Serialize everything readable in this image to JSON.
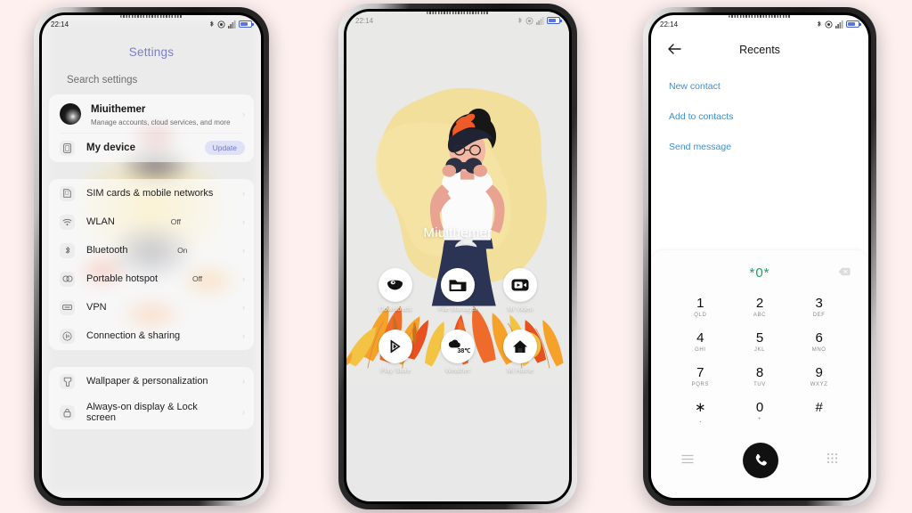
{
  "page": {
    "background_color": "#fdf0ef",
    "phone_count": 3
  },
  "status_bar": {
    "time": "22:14",
    "icons": [
      "bluetooth-icon",
      "dnd-icon",
      "signal-icon",
      "battery-icon"
    ]
  },
  "phone_settings": {
    "title": "Settings",
    "search_placeholder": "Search settings",
    "account": {
      "name": "Miuithemer",
      "subtitle": "Manage accounts, cloud services, and more"
    },
    "device": {
      "label": "My device",
      "badge": "Update",
      "badge_color": "#6f78c8",
      "badge_bg": "#dfe1f7"
    },
    "groups": [
      {
        "items": [
          {
            "label": "SIM cards & mobile networks",
            "value": "",
            "icon": "sim-card-icon"
          },
          {
            "label": "WLAN",
            "value": "Off",
            "icon": "wifi-icon"
          },
          {
            "label": "Bluetooth",
            "value": "On",
            "icon": "bluetooth-icon"
          },
          {
            "label": "Portable hotspot",
            "value": "Off",
            "icon": "hotspot-icon"
          },
          {
            "label": "VPN",
            "value": "",
            "icon": "vpn-icon"
          },
          {
            "label": "Connection & sharing",
            "value": "",
            "icon": "connection-sharing-icon"
          }
        ]
      },
      {
        "items": [
          {
            "label": "Wallpaper & personalization",
            "value": "",
            "icon": "wallpaper-icon"
          },
          {
            "label": "Always-on display & Lock screen",
            "value": "",
            "icon": "lock-icon"
          }
        ]
      }
    ],
    "title_color": "#7b7fc4"
  },
  "phone_home": {
    "wallpaper_name": "Miuithemer",
    "wallpaper_description": "Illustrated woman with binoculars on yellow blob with autumn leaves",
    "apps": [
      {
        "label": "Downloads",
        "icon": "downloads-icon"
      },
      {
        "label": "File Manager",
        "icon": "folder-icon"
      },
      {
        "label": "Mi Video",
        "icon": "video-play-icon"
      },
      {
        "label": "Play Store",
        "icon": "play-store-icon"
      },
      {
        "label": "Weather",
        "icon": "weather-cloud-icon",
        "badge": "38℃"
      },
      {
        "label": "Mi Home",
        "icon": "home-icon"
      }
    ]
  },
  "phone_dialer": {
    "title": "Recents",
    "back_icon": "back-arrow-icon",
    "links": [
      "New contact",
      "Add to contacts",
      "Send message"
    ],
    "link_color": "#3b8fd4",
    "entry": "*0*",
    "entry_color": "#1aa463",
    "backspace_icon": "backspace-icon",
    "keys": [
      {
        "digit": "1",
        "sub": "QLD"
      },
      {
        "digit": "2",
        "sub": "ABC"
      },
      {
        "digit": "3",
        "sub": "DEF"
      },
      {
        "digit": "4",
        "sub": "GHI"
      },
      {
        "digit": "5",
        "sub": "JKL"
      },
      {
        "digit": "6",
        "sub": "MNO"
      },
      {
        "digit": "7",
        "sub": "PQRS"
      },
      {
        "digit": "8",
        "sub": "TUV"
      },
      {
        "digit": "9",
        "sub": "WXYZ"
      },
      {
        "digit": "∗",
        "sub": "·"
      },
      {
        "digit": "0",
        "sub": "+"
      },
      {
        "digit": "#",
        "sub": ""
      }
    ],
    "bottom": {
      "menu_icon": "menu-icon",
      "call_icon": "call-icon",
      "keypad_icon": "keypad-icon"
    }
  }
}
